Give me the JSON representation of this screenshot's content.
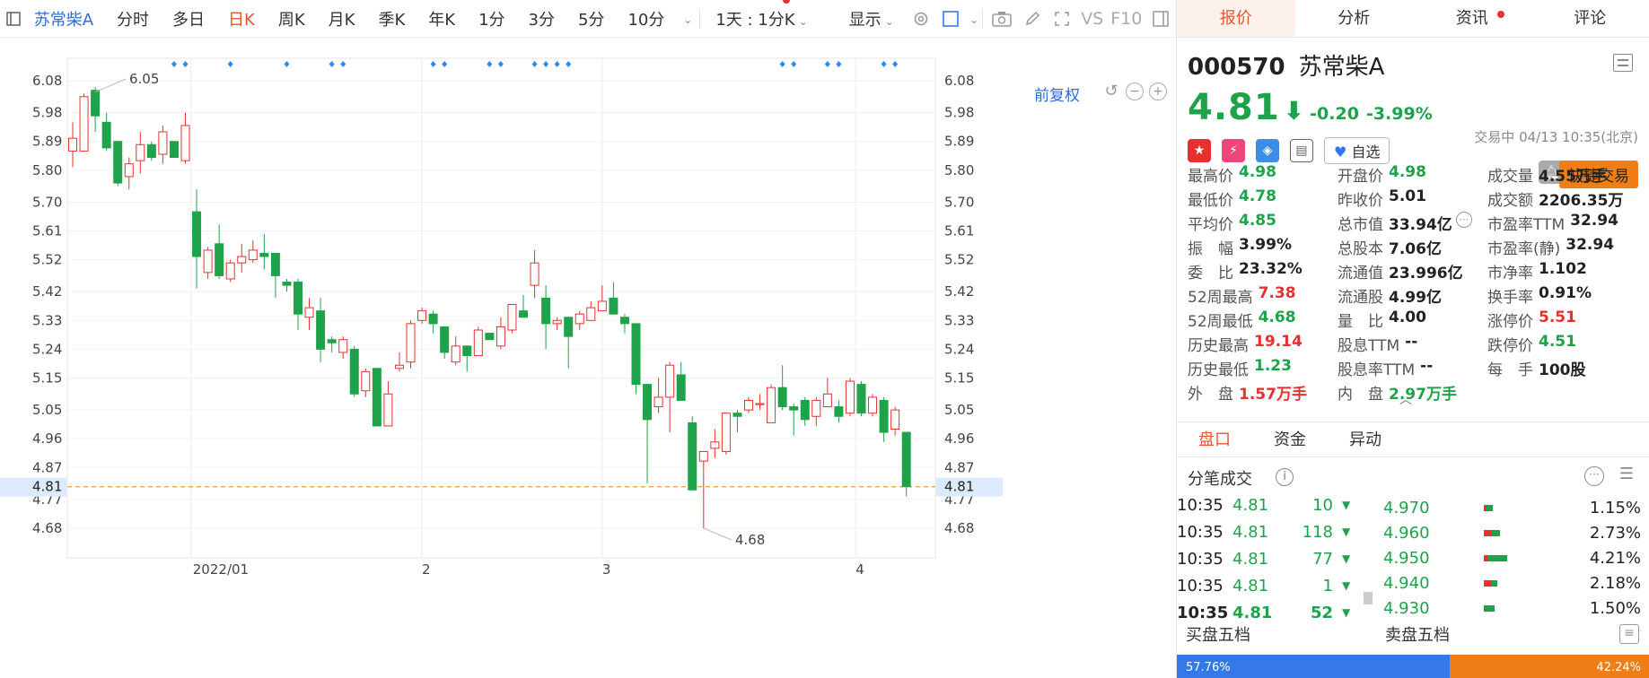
{
  "toolbar": {
    "stock_name": "苏常柴A",
    "periods": [
      "分时",
      "多日",
      "日K",
      "周K",
      "月K",
      "季K",
      "年K",
      "1分",
      "3分",
      "5分",
      "10分"
    ],
    "active_period": "日K",
    "range_select": "1天 : 1分K",
    "display_select": "显示",
    "icons": [
      "settings-icon",
      "color-square-icon",
      "camera-icon",
      "pen-icon",
      "expand-icon",
      "vs-icon",
      "f10-icon",
      "panel-toggle-icon"
    ],
    "vs_label": "VS",
    "f10_label": "F10"
  },
  "chart": {
    "adjust_label": "前复权",
    "ticks": [
      "6.08",
      "5.98",
      "5.89",
      "5.80",
      "5.70",
      "5.61",
      "5.52",
      "5.42",
      "5.33",
      "5.24",
      "5.15",
      "5.05",
      "4.96",
      "4.87",
      "4.77",
      "4.68"
    ],
    "current_price_label": "4.81",
    "x_labels": [
      "2022/01",
      "2",
      "3",
      "4"
    ],
    "max_label": "6.05",
    "min_label": "4.68",
    "colors": {
      "up": "#e8312f",
      "down": "#1ea34b",
      "marker": "#2b8af3",
      "price_line": "#f0a14a"
    }
  },
  "chart_data": {
    "type": "candlestick",
    "ylim": [
      4.62,
      6.12
    ],
    "yticks": [
      6.08,
      5.98,
      5.89,
      5.8,
      5.7,
      5.61,
      5.52,
      5.42,
      5.33,
      5.24,
      5.15,
      5.05,
      4.96,
      4.87,
      4.77,
      4.68
    ],
    "current": 4.81,
    "max": 6.05,
    "min": 4.68,
    "candles": [
      {
        "o": 5.86,
        "c": 5.9,
        "h": 5.95,
        "l": 5.81
      },
      {
        "o": 5.86,
        "c": 6.03,
        "h": 6.04,
        "l": 5.86
      },
      {
        "o": 6.05,
        "c": 5.97,
        "h": 6.06,
        "l": 5.92
      },
      {
        "o": 5.95,
        "c": 5.87,
        "h": 5.98,
        "l": 5.86
      },
      {
        "o": 5.89,
        "c": 5.76,
        "h": 5.89,
        "l": 5.75
      },
      {
        "o": 5.78,
        "c": 5.82,
        "h": 5.84,
        "l": 5.74
      },
      {
        "o": 5.83,
        "c": 5.88,
        "h": 5.92,
        "l": 5.79
      },
      {
        "o": 5.88,
        "c": 5.84,
        "h": 5.89,
        "l": 5.83
      },
      {
        "o": 5.85,
        "c": 5.92,
        "h": 5.94,
        "l": 5.82
      },
      {
        "o": 5.89,
        "c": 5.84,
        "h": 5.89,
        "l": 5.84
      },
      {
        "o": 5.83,
        "c": 5.94,
        "h": 5.98,
        "l": 5.82
      },
      {
        "o": 5.67,
        "c": 5.53,
        "h": 5.74,
        "l": 5.43
      },
      {
        "o": 5.48,
        "c": 5.55,
        "h": 5.56,
        "l": 5.46
      },
      {
        "o": 5.57,
        "c": 5.47,
        "h": 5.63,
        "l": 5.46
      },
      {
        "o": 5.46,
        "c": 5.51,
        "h": 5.52,
        "l": 5.45
      },
      {
        "o": 5.51,
        "c": 5.53,
        "h": 5.57,
        "l": 5.48
      },
      {
        "o": 5.52,
        "c": 5.55,
        "h": 5.58,
        "l": 5.51
      },
      {
        "o": 5.54,
        "c": 5.53,
        "h": 5.6,
        "l": 5.49
      },
      {
        "o": 5.54,
        "c": 5.47,
        "h": 5.54,
        "l": 5.4
      },
      {
        "o": 5.45,
        "c": 5.44,
        "h": 5.46,
        "l": 5.42
      },
      {
        "o": 5.45,
        "c": 5.35,
        "h": 5.46,
        "l": 5.3
      },
      {
        "o": 5.34,
        "c": 5.37,
        "h": 5.4,
        "l": 5.3
      },
      {
        "o": 5.36,
        "c": 5.24,
        "h": 5.4,
        "l": 5.2
      },
      {
        "o": 5.27,
        "c": 5.26,
        "h": 5.28,
        "l": 5.23
      },
      {
        "o": 5.23,
        "c": 5.27,
        "h": 5.28,
        "l": 5.21
      },
      {
        "o": 5.24,
        "c": 5.1,
        "h": 5.25,
        "l": 5.09
      },
      {
        "o": 5.11,
        "c": 5.17,
        "h": 5.18,
        "l": 5.09
      },
      {
        "o": 5.18,
        "c": 5.0,
        "h": 5.18,
        "l": 5.0
      },
      {
        "o": 5.0,
        "c": 5.1,
        "h": 5.14,
        "l": 5.0
      },
      {
        "o": 5.18,
        "c": 5.19,
        "h": 5.23,
        "l": 5.17
      },
      {
        "o": 5.2,
        "c": 5.32,
        "h": 5.33,
        "l": 5.18
      },
      {
        "o": 5.33,
        "c": 5.36,
        "h": 5.37,
        "l": 5.32
      },
      {
        "o": 5.35,
        "c": 5.32,
        "h": 5.36,
        "l": 5.29
      },
      {
        "o": 5.31,
        "c": 5.23,
        "h": 5.31,
        "l": 5.21
      },
      {
        "o": 5.2,
        "c": 5.25,
        "h": 5.28,
        "l": 5.19
      },
      {
        "o": 5.25,
        "c": 5.22,
        "h": 5.25,
        "l": 5.17
      },
      {
        "o": 5.22,
        "c": 5.3,
        "h": 5.31,
        "l": 5.22
      },
      {
        "o": 5.29,
        "c": 5.27,
        "h": 5.29,
        "l": 5.27
      },
      {
        "o": 5.25,
        "c": 5.31,
        "h": 5.34,
        "l": 5.24
      },
      {
        "o": 5.3,
        "c": 5.38,
        "h": 5.38,
        "l": 5.29
      },
      {
        "o": 5.36,
        "c": 5.34,
        "h": 5.41,
        "l": 5.34
      },
      {
        "o": 5.44,
        "c": 5.51,
        "h": 5.55,
        "l": 5.4
      },
      {
        "o": 5.4,
        "c": 5.32,
        "h": 5.44,
        "l": 5.24
      },
      {
        "o": 5.32,
        "c": 5.33,
        "h": 5.34,
        "l": 5.3
      },
      {
        "o": 5.34,
        "c": 5.28,
        "h": 5.34,
        "l": 5.18
      },
      {
        "o": 5.32,
        "c": 5.35,
        "h": 5.36,
        "l": 5.3
      },
      {
        "o": 5.33,
        "c": 5.37,
        "h": 5.39,
        "l": 5.33
      },
      {
        "o": 5.36,
        "c": 5.39,
        "h": 5.44,
        "l": 5.36
      },
      {
        "o": 5.4,
        "c": 5.35,
        "h": 5.45,
        "l": 5.35
      },
      {
        "o": 5.34,
        "c": 5.32,
        "h": 5.35,
        "l": 5.29
      },
      {
        "o": 5.32,
        "c": 5.13,
        "h": 5.32,
        "l": 5.1
      },
      {
        "o": 5.13,
        "c": 5.02,
        "h": 5.13,
        "l": 4.82
      },
      {
        "o": 5.06,
        "c": 5.09,
        "h": 5.15,
        "l": 5.04
      },
      {
        "o": 5.09,
        "c": 5.19,
        "h": 5.2,
        "l": 4.98
      },
      {
        "o": 5.16,
        "c": 5.08,
        "h": 5.2,
        "l": 5.08
      },
      {
        "o": 5.01,
        "c": 4.8,
        "h": 5.03,
        "l": 4.8
      },
      {
        "o": 4.89,
        "c": 4.92,
        "h": 4.92,
        "l": 4.68
      },
      {
        "o": 4.93,
        "c": 4.95,
        "h": 4.99,
        "l": 4.9
      },
      {
        "o": 4.92,
        "c": 5.04,
        "h": 5.04,
        "l": 4.91
      },
      {
        "o": 5.04,
        "c": 5.03,
        "h": 5.05,
        "l": 4.98
      },
      {
        "o": 5.05,
        "c": 5.08,
        "h": 5.09,
        "l": 5.04
      },
      {
        "o": 5.07,
        "c": 5.07,
        "h": 5.1,
        "l": 5.05
      },
      {
        "o": 5.01,
        "c": 5.12,
        "h": 5.13,
        "l": 5.01
      },
      {
        "o": 5.12,
        "c": 5.06,
        "h": 5.19,
        "l": 5.05
      },
      {
        "o": 5.06,
        "c": 5.05,
        "h": 5.07,
        "l": 4.97
      },
      {
        "o": 5.08,
        "c": 5.02,
        "h": 5.09,
        "l": 5.0
      },
      {
        "o": 5.03,
        "c": 5.08,
        "h": 5.09,
        "l": 5.0
      },
      {
        "o": 5.06,
        "c": 5.1,
        "h": 5.15,
        "l": 5.06
      },
      {
        "o": 5.06,
        "c": 5.03,
        "h": 5.08,
        "l": 5.01
      },
      {
        "o": 5.04,
        "c": 5.14,
        "h": 5.15,
        "l": 5.03
      },
      {
        "o": 5.13,
        "c": 5.04,
        "h": 5.14,
        "l": 5.03
      },
      {
        "o": 5.04,
        "c": 5.09,
        "h": 5.1,
        "l": 5.03
      },
      {
        "o": 5.08,
        "c": 4.98,
        "h": 5.09,
        "l": 4.95
      },
      {
        "o": 4.99,
        "c": 5.05,
        "h": 5.06,
        "l": 4.97
      },
      {
        "o": 4.98,
        "c": 4.81,
        "h": 4.98,
        "l": 4.78
      }
    ],
    "markers": [
      9,
      10,
      14,
      19,
      23,
      24,
      32,
      33,
      37,
      38,
      41,
      42,
      43,
      44,
      63,
      64,
      67,
      68,
      72,
      73
    ],
    "x_labels": [
      {
        "label": "2022/01",
        "i": 10.5
      },
      {
        "label": "2",
        "i": 31
      },
      {
        "label": "3",
        "i": 47
      },
      {
        "label": "4",
        "i": 69.5
      }
    ]
  },
  "panel": {
    "tabs": [
      "报价",
      "分析",
      "资讯",
      "评论"
    ],
    "active_tab": "报价",
    "code": "000570",
    "name": "苏常柴A",
    "price": "4.81",
    "change": "-0.20",
    "change_pct": "-3.99%",
    "status": "交易中 04/13 10:35(北京)",
    "watch_label": "自选",
    "quick_trade": "快捷交易",
    "stats": [
      [
        {
          "label": "最高价",
          "value": "4.98",
          "c": "dn"
        },
        {
          "label": "开盘价",
          "value": "4.98",
          "c": "dn"
        },
        {
          "label": "成交量",
          "value": "4.55万手",
          "c": "eq"
        }
      ],
      [
        {
          "label": "最低价",
          "value": "4.78",
          "c": "dn"
        },
        {
          "label": "昨收价",
          "value": "5.01",
          "c": "eq"
        },
        {
          "label": "成交额",
          "value": "2206.35万",
          "c": "eq"
        }
      ],
      [
        {
          "label": "平均价",
          "value": "4.85",
          "c": "dn"
        },
        {
          "label": "总市值",
          "value": "33.94亿",
          "c": "eq"
        },
        {
          "label": "市盈率TTM",
          "value": "32.94",
          "c": "eq"
        }
      ],
      [
        {
          "label": "振　幅",
          "value": "3.99%",
          "c": "eq"
        },
        {
          "label": "总股本",
          "value": "7.06亿",
          "c": "eq"
        },
        {
          "label": "市盈率(静)",
          "value": "32.94",
          "c": "eq"
        }
      ],
      [
        {
          "label": "委　比",
          "value": "23.32%",
          "c": "eq"
        },
        {
          "label": "流通值",
          "value": "23.996亿",
          "c": "eq"
        },
        {
          "label": "市净率",
          "value": "1.102",
          "c": "eq"
        }
      ],
      [
        {
          "label": "52周最高",
          "value": "7.38",
          "c": "up"
        },
        {
          "label": "流通股",
          "value": "4.99亿",
          "c": "eq"
        },
        {
          "label": "换手率",
          "value": "0.91%",
          "c": "eq"
        }
      ],
      [
        {
          "label": "52周最低",
          "value": "4.68",
          "c": "dn"
        },
        {
          "label": "量　比",
          "value": "4.00",
          "c": "eq"
        },
        {
          "label": "涨停价",
          "value": "5.51",
          "c": "up"
        }
      ],
      [
        {
          "label": "历史最高",
          "value": "19.14",
          "c": "up"
        },
        {
          "label": "股息TTM",
          "value": "--",
          "c": "eq"
        },
        {
          "label": "跌停价",
          "value": "4.51",
          "c": "dn"
        }
      ],
      [
        {
          "label": "历史最低",
          "value": "1.23",
          "c": "dn"
        },
        {
          "label": "股息率TTM",
          "value": "--",
          "c": "eq"
        },
        {
          "label": "每　手",
          "value": "100股",
          "c": "eq"
        }
      ],
      [
        {
          "label": "外　盘",
          "value": "1.57万手",
          "c": "up"
        },
        {
          "label": "内　盘",
          "value": "2.97万手",
          "c": "dn"
        },
        {
          "label": "",
          "value": "",
          "c": "eq"
        }
      ]
    ],
    "subtabs": [
      "盘口",
      "资金",
      "异动"
    ],
    "active_subtab": "盘口",
    "fenbi_title": "分笔成交",
    "trades": [
      {
        "t": "10:35",
        "p": "4.81",
        "v": "10"
      },
      {
        "t": "10:35",
        "p": "4.81",
        "v": "118"
      },
      {
        "t": "10:35",
        "p": "4.81",
        "v": "77"
      },
      {
        "t": "10:35",
        "p": "4.81",
        "v": "1"
      },
      {
        "t": "10:35",
        "p": "4.81",
        "v": "52"
      }
    ],
    "levels": [
      {
        "p": "4.970",
        "pct": "1.15%",
        "r": 0.25,
        "g": 0.75,
        "w": 0.08
      },
      {
        "p": "4.960",
        "pct": "2.73%",
        "r": 0.5,
        "g": 0.5,
        "w": 0.18
      },
      {
        "p": "4.950",
        "pct": "4.21%",
        "r": 0.15,
        "g": 0.85,
        "w": 0.28
      },
      {
        "p": "4.940",
        "pct": "2.18%",
        "r": 0.5,
        "g": 0.5,
        "w": 0.14
      },
      {
        "p": "4.930",
        "pct": "1.50%",
        "r": 0.1,
        "g": 0.9,
        "w": 0.1
      }
    ],
    "buy5_label": "买盘五档",
    "sell5_label": "卖盘五档",
    "buy_pct": "57.76%",
    "sell_pct": "42.24%",
    "buy_ratio": 0.5776
  }
}
